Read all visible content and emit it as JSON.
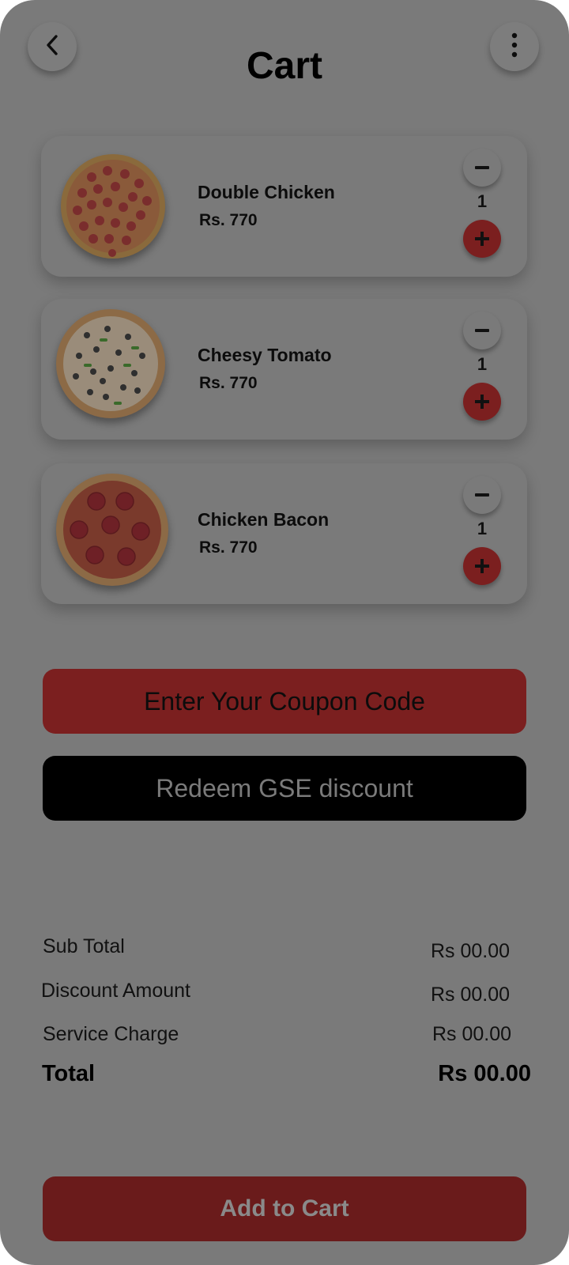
{
  "header": {
    "title": "Cart",
    "back_icon": "chevron-left-icon",
    "menu_icon": "more-vertical-icon"
  },
  "cart_items": [
    {
      "name": "Double Chicken",
      "price": "Rs. 770",
      "quantity": "1",
      "image": "pepperoni-pizza"
    },
    {
      "name": "Cheesy Tomato",
      "price": "Rs. 770",
      "quantity": "1",
      "image": "veggie-pizza"
    },
    {
      "name": "Chicken Bacon",
      "price": "Rs. 770",
      "quantity": "1",
      "image": "salami-pizza"
    }
  ],
  "actions": {
    "coupon_label": "Enter Your Coupon Code",
    "redeem_label": "Redeem GSE discount",
    "add_to_cart_label": "Add to Cart"
  },
  "summary": {
    "subtotal_label": "Sub Total",
    "subtotal_value": "Rs 00.00",
    "discount_label": "Discount Amount",
    "discount_value": "Rs 00.00",
    "service_label": "Service Charge",
    "service_value": "Rs 00.00",
    "total_label": "Total",
    "total_value": "Rs 00.00"
  },
  "colors": {
    "overlay_background": "#7a7a7a",
    "accent_red": "#7b1f1f",
    "dark_button": "#000000"
  }
}
